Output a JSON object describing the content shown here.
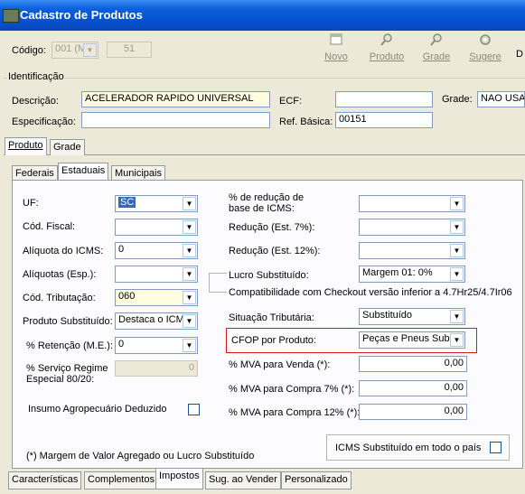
{
  "window": {
    "title": "Cadastro de Produtos"
  },
  "toolbar": {
    "codigo_label": "Código:",
    "codigo_select": "001 (M",
    "codigo_value": "51",
    "buttons": [
      {
        "label": "Novo",
        "icon": "new-icon"
      },
      {
        "label": "Produto",
        "icon": "search-icon"
      },
      {
        "label": "Grade",
        "icon": "search-icon"
      },
      {
        "label": "Sugere",
        "icon": "gear-icon"
      }
    ],
    "extra": "D"
  },
  "ident": {
    "group_label": "Identificação",
    "descricao_label": "Descrição:",
    "descricao_value": "ACELERADOR RAPIDO UNIVERSAL",
    "ecf_label": "ECF:",
    "ecf_value": "",
    "grade_label": "Grade:",
    "grade_value": "NAO USA",
    "especificacao_label": "Especificação:",
    "especificacao_value": "",
    "refbasica_label": "Ref. Básica:",
    "refbasica_value": "00151"
  },
  "main_tabs": [
    "Produto",
    "Grade"
  ],
  "sub_tabs": [
    "Federais",
    "Estaduais",
    "Municipais"
  ],
  "left": {
    "uf_label": "UF:",
    "uf_value": "SC",
    "codfiscal_label": "Cód. Fiscal:",
    "codfiscal_value": "",
    "aliqicms_label": "Alíquota do ICMS:",
    "aliqicms_value": "0",
    "aliqesp_label": "Alíquotas (Esp.):",
    "aliqesp_value": "",
    "codtrib_label": "Cód. Tributação:",
    "codtrib_value": "060",
    "prodsubst_label": "Produto Substituído:",
    "prodsubst_value": "Destaca o ICMS",
    "retencao_label": "% Retenção (M.E.):",
    "retencao_value": "0",
    "servico_label_1": "% Serviço Regime",
    "servico_label_2": "Especial 80/20:",
    "servico_value": "0",
    "insumo_label": "Insumo Agropecuário Deduzido"
  },
  "right": {
    "reducao_label_1": "% de redução de",
    "reducao_label_2": "base de ICMS:",
    "reducao_value": "",
    "red7_label": "Redução (Est. 7%):",
    "red7_value": "",
    "red12_label": "Redução (Est. 12%):",
    "red12_value": "",
    "lucro_label": "Lucro Substituído:",
    "lucro_value": "Margem 01: 0%",
    "compat_label": "Compatibilidade com Checkout versão inferior a 4.7Hr25/4.7Ir06",
    "situacao_label": "Situação Tributária:",
    "situacao_value": "Substituído",
    "cfop_label": "CFOP por Produto:",
    "cfop_value": "Peças e Pneus Subs",
    "mva_venda_label": "% MVA para Venda (*):",
    "mva_venda_value": "0,00",
    "mva_c7_label": "% MVA para Compra 7% (*):",
    "mva_c7_value": "0,00",
    "mva_c12_label": "% MVA para Compra 12% (*):",
    "mva_c12_value": "0,00"
  },
  "footnote": "(*) Margem de Valor Agregado ou Lucro Substituído",
  "icms_all_label": "ICMS Substituído em todo o país",
  "bottom_tabs": [
    "Características",
    "Complementos",
    "Impostos",
    "Sug. ao Vender",
    "Personalizado"
  ],
  "colors": {
    "title_bar": "#0550d0",
    "highlight_box": "#d61a1a",
    "selection": "#316ac5",
    "field_yellow": "#fffde0"
  }
}
